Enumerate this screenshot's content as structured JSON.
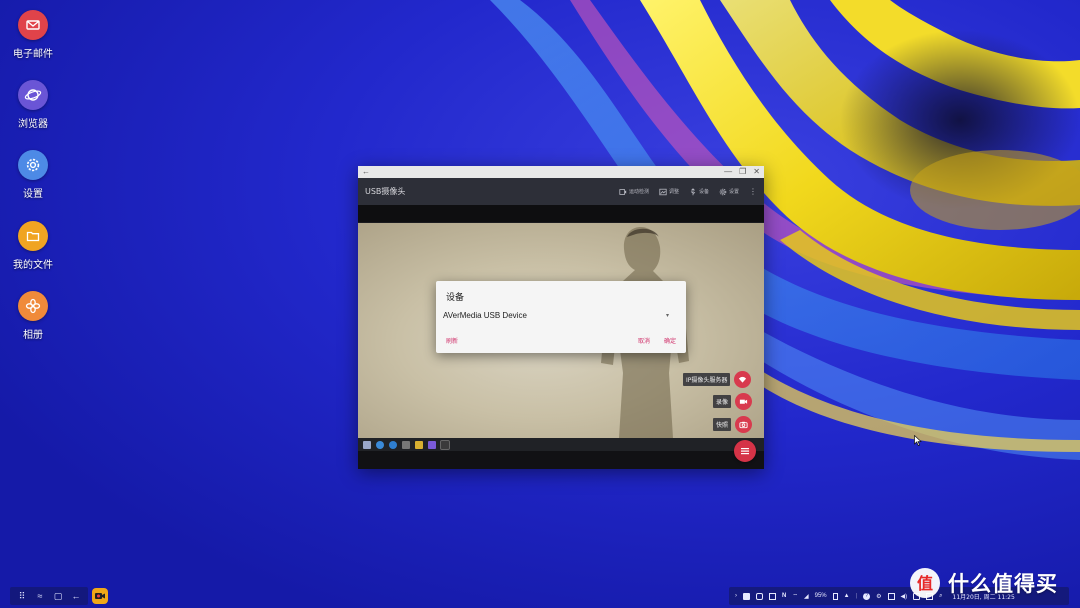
{
  "desktop": {
    "icons": [
      {
        "label": "电子邮件",
        "icon": "email-icon",
        "color": "#e0434a"
      },
      {
        "label": "浏览器",
        "icon": "browser-icon",
        "color": "#6a55d6"
      },
      {
        "label": "设置",
        "icon": "settings-icon",
        "color": "#4d8ae6"
      },
      {
        "label": "我的文件",
        "icon": "folder-icon",
        "color": "#f0a422"
      },
      {
        "label": "相册",
        "icon": "gallery-icon",
        "color": "#f08a3a"
      }
    ]
  },
  "window": {
    "app_title": "USB摄像头",
    "toolbar": {
      "motion_detect": "运动检测",
      "adjust": "调整",
      "device": "设备",
      "settings": "设置"
    },
    "fabs": {
      "ip_server": "IP摄像头服务器",
      "record": "录像",
      "snapshot": "快照"
    }
  },
  "dialog": {
    "title": "设备",
    "selected_device": "AVerMedia USB Device",
    "refresh_label": "刷新",
    "cancel_label": "取消",
    "ok_label": "确定",
    "accent": "#d0306a"
  },
  "system_tray": {
    "battery": "95%",
    "clock": "11月20日, 周二 11:25"
  },
  "watermark": {
    "badge": "值",
    "text": "什么值得买"
  }
}
